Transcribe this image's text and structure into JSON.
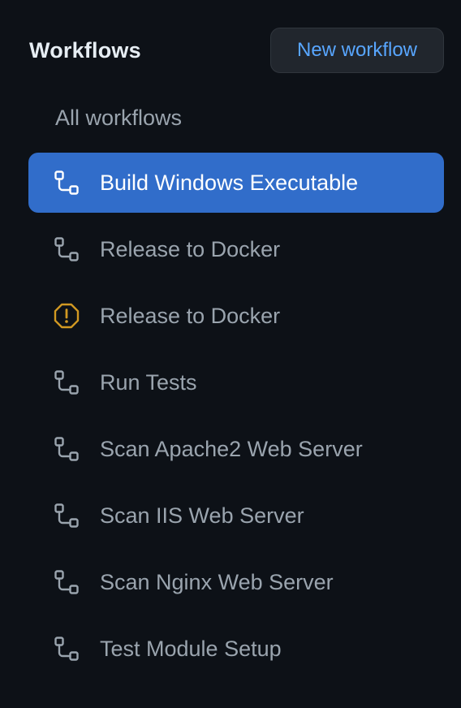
{
  "header": {
    "title": "Workflows",
    "new_workflow_label": "New workflow"
  },
  "all_workflows_label": "All workflows",
  "colors": {
    "background": "#0d1117",
    "selected": "#316dca",
    "accent": "#58a6ff",
    "warning": "#d29922",
    "muted_text": "#9aa4ae"
  },
  "workflows": [
    {
      "label": "Build Windows Executable",
      "icon": "workflow-icon",
      "selected": true
    },
    {
      "label": "Release to Docker",
      "icon": "workflow-icon",
      "selected": false
    },
    {
      "label": "Release to Docker",
      "icon": "warning-icon",
      "selected": false
    },
    {
      "label": "Run Tests",
      "icon": "workflow-icon",
      "selected": false
    },
    {
      "label": "Scan Apache2 Web Server",
      "icon": "workflow-icon",
      "selected": false
    },
    {
      "label": "Scan IIS Web Server",
      "icon": "workflow-icon",
      "selected": false
    },
    {
      "label": "Scan Nginx Web Server",
      "icon": "workflow-icon",
      "selected": false
    },
    {
      "label": "Test Module Setup",
      "icon": "workflow-icon",
      "selected": false
    }
  ]
}
